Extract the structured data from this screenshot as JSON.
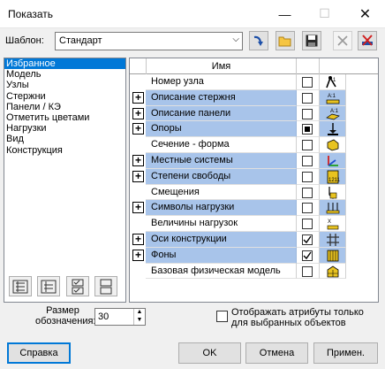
{
  "window": {
    "title": "Показать"
  },
  "template": {
    "label": "Шаблон:",
    "value": "Стандарт"
  },
  "categories": [
    {
      "label": "Избранное",
      "selected": true
    },
    {
      "label": "Модель"
    },
    {
      "label": "Узлы"
    },
    {
      "label": "Стержни"
    },
    {
      "label": "Панели / КЭ"
    },
    {
      "label": "Отметить цветами"
    },
    {
      "label": "Нагрузки"
    },
    {
      "label": "Вид"
    },
    {
      "label": "Конструкция"
    }
  ],
  "grid": {
    "header": "Имя",
    "rows": [
      {
        "name": "Номер узла",
        "expandable": false,
        "highlighted": false,
        "checked": "off",
        "icon": "node-number-icon"
      },
      {
        "name": "Описание стержня",
        "expandable": true,
        "highlighted": true,
        "checked": "off",
        "icon": "bar-description-icon"
      },
      {
        "name": "Описание панели",
        "expandable": true,
        "highlighted": true,
        "checked": "off",
        "icon": "panel-description-icon"
      },
      {
        "name": "Опоры",
        "expandable": true,
        "highlighted": true,
        "checked": "partial",
        "icon": "supports-icon"
      },
      {
        "name": "Сечение - форма",
        "expandable": false,
        "highlighted": false,
        "checked": "off",
        "icon": "section-shape-icon"
      },
      {
        "name": "Местные системы",
        "expandable": true,
        "highlighted": true,
        "checked": "off",
        "icon": "local-systems-icon"
      },
      {
        "name": "Степени свободы",
        "expandable": true,
        "highlighted": true,
        "checked": "off",
        "icon": "degrees-of-freedom-icon"
      },
      {
        "name": "Смещения",
        "expandable": false,
        "highlighted": false,
        "checked": "off",
        "icon": "offsets-icon"
      },
      {
        "name": "Символы нагрузки",
        "expandable": true,
        "highlighted": true,
        "checked": "off",
        "icon": "load-symbols-icon"
      },
      {
        "name": "Величины нагрузок",
        "expandable": false,
        "highlighted": false,
        "checked": "off",
        "icon": "load-values-icon"
      },
      {
        "name": "Оси конструкции",
        "expandable": true,
        "highlighted": true,
        "checked": "on",
        "icon": "structure-axes-icon"
      },
      {
        "name": "Фоны",
        "expandable": true,
        "highlighted": true,
        "checked": "on",
        "icon": "backgrounds-icon"
      },
      {
        "name": "Базовая физическая модель",
        "expandable": false,
        "highlighted": false,
        "checked": "off",
        "icon": "physical-model-icon"
      }
    ]
  },
  "size": {
    "label": "Размер обозначения:",
    "value": "30"
  },
  "option": {
    "label": "Отображать атрибуты только для выбранных объектов",
    "checked": false
  },
  "buttons": {
    "help": "Справка",
    "ok": "OK",
    "cancel": "Отмена",
    "apply": "Примен."
  },
  "colors": {
    "selection": "#0078d7",
    "row_highlight": "#a8c4ea"
  }
}
